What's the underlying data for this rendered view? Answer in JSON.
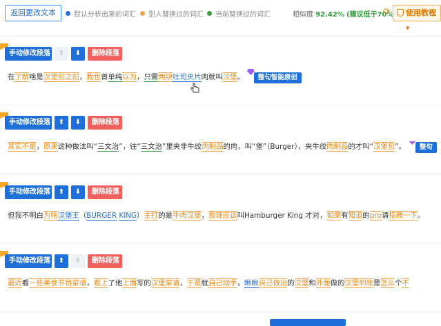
{
  "header": {
    "back_label": "返回更改文本",
    "legend": [
      {
        "label": "默认分析出来的词汇",
        "color": "#2a6fd6"
      },
      {
        "label": "别人替换过的词汇",
        "color": "#f0a347"
      },
      {
        "label": "当前替换过的词汇",
        "color": "#3f9b42"
      }
    ],
    "similarity_label": "相似度",
    "similarity_value": "92.42%",
    "similarity_hint": "(建议低于70%)",
    "tutorial_label": "使用教程"
  },
  "toolbar": {
    "manual_label": "手动修改段落",
    "up_icon": "arrow-up-icon",
    "down_icon": "arrow-down-icon",
    "delete_label": "删除段落",
    "smart_label": "整句智能原创",
    "smart_label_cut": "整句"
  },
  "paragraphs": [
    {
      "segments": [
        {
          "t": "在",
          "s": ""
        },
        {
          "t": "了解",
          "s": "o"
        },
        {
          "t": "啥是",
          "s": ""
        },
        {
          "t": "汉堡包",
          "s": "o"
        },
        {
          "t": "之前",
          "s": "o"
        },
        {
          "t": "，",
          "s": ""
        },
        {
          "t": "我也",
          "s": "o"
        },
        {
          "t": "曾",
          "s": ""
        },
        {
          "t": "单纯",
          "s": "g"
        },
        {
          "t": "以为",
          "s": "o"
        },
        {
          "t": "，",
          "s": ""
        },
        {
          "t": "只需",
          "s": "g"
        },
        {
          "t": "两块",
          "s": "o"
        },
        {
          "t": "吐司",
          "s": "b"
        },
        {
          "t": "夹片",
          "s": "b"
        },
        {
          "t": "肉就叫",
          "s": ""
        },
        {
          "t": "汉堡",
          "s": "o"
        },
        {
          "t": "。",
          "s": ""
        }
      ]
    },
    {
      "segments": [
        {
          "t": "其实",
          "s": "o"
        },
        {
          "t": "不是",
          "s": "o"
        },
        {
          "t": "，",
          "s": ""
        },
        {
          "t": "原来",
          "s": "o"
        },
        {
          "t": "这种做法叫“",
          "s": ""
        },
        {
          "t": "三文治",
          "s": "g"
        },
        {
          "t": "”，往“",
          "s": ""
        },
        {
          "t": "三文治",
          "s": "g"
        },
        {
          "t": "”里夹非牛绞",
          "s": ""
        },
        {
          "t": "肉制品",
          "s": "o"
        },
        {
          "t": "的肉，叫“堡”（Burger），夹牛绞",
          "s": ""
        },
        {
          "t": "肉制品",
          "s": "o"
        },
        {
          "t": "的才叫“",
          "s": ""
        },
        {
          "t": "汉堡包",
          "s": "o"
        },
        {
          "t": "”。",
          "s": ""
        }
      ]
    },
    {
      "segments": [
        {
          "t": "但我不明白",
          "s": ""
        },
        {
          "t": "为啥",
          "s": "o"
        },
        {
          "t": "汉堡王",
          "s": "b"
        },
        {
          "t": "（",
          "s": ""
        },
        {
          "t": "BURGER",
          "s": "b"
        },
        {
          "t": " ",
          "s": ""
        },
        {
          "t": "KING",
          "s": "b"
        },
        {
          "t": "）",
          "s": ""
        },
        {
          "t": "主打",
          "s": "o"
        },
        {
          "t": "的是",
          "s": ""
        },
        {
          "t": "牛肉汉堡",
          "s": "o"
        },
        {
          "t": "，",
          "s": ""
        },
        {
          "t": "按理",
          "s": "o"
        },
        {
          "t": "应该",
          "s": "o"
        },
        {
          "t": "叫Hamburger King 才对，",
          "s": ""
        },
        {
          "t": "如果",
          "s": "o"
        },
        {
          "t": "有",
          "s": ""
        },
        {
          "t": "知道",
          "s": "o"
        },
        {
          "t": "的",
          "s": ""
        },
        {
          "t": "pro",
          "s": "o"
        },
        {
          "t": "请",
          "s": ""
        },
        {
          "t": "指教",
          "s": "o"
        },
        {
          "t": "一下",
          "s": "o"
        },
        {
          "t": "。",
          "s": ""
        }
      ]
    },
    {
      "segments": [
        {
          "t": "最近",
          "s": "o"
        },
        {
          "t": "看",
          "s": ""
        },
        {
          "t": "一些",
          "s": "o"
        },
        {
          "t": "美食节目",
          "s": "o"
        },
        {
          "t": "菜谱",
          "s": "o"
        },
        {
          "t": "，",
          "s": ""
        },
        {
          "t": "看上",
          "s": "o"
        },
        {
          "t": "了他",
          "s": ""
        },
        {
          "t": "上面",
          "s": "o"
        },
        {
          "t": "写的",
          "s": ""
        },
        {
          "t": "汉堡",
          "s": "o"
        },
        {
          "t": "菜谱",
          "s": "o"
        },
        {
          "t": "，",
          "s": ""
        },
        {
          "t": "于是",
          "s": "o"
        },
        {
          "t": "就",
          "s": ""
        },
        {
          "t": "自己",
          "s": "o"
        },
        {
          "t": "动手",
          "s": "o"
        },
        {
          "t": "，",
          "s": ""
        },
        {
          "t": "瞅瞅",
          "s": "b"
        },
        {
          "t": "自己",
          "s": "o"
        },
        {
          "t": "做出",
          "s": "o"
        },
        {
          "t": "的",
          "s": ""
        },
        {
          "t": "汉堡",
          "s": "o"
        },
        {
          "t": "和",
          "s": ""
        },
        {
          "t": "外面",
          "s": "o"
        },
        {
          "t": "做的",
          "s": ""
        },
        {
          "t": "汉堡",
          "s": "o"
        },
        {
          "t": "到底",
          "s": "o"
        },
        {
          "t": "是",
          "s": ""
        },
        {
          "t": "怎么",
          "s": "o"
        },
        {
          "t": "个",
          "s": ""
        },
        {
          "t": "不",
          "s": "o"
        }
      ]
    }
  ]
}
